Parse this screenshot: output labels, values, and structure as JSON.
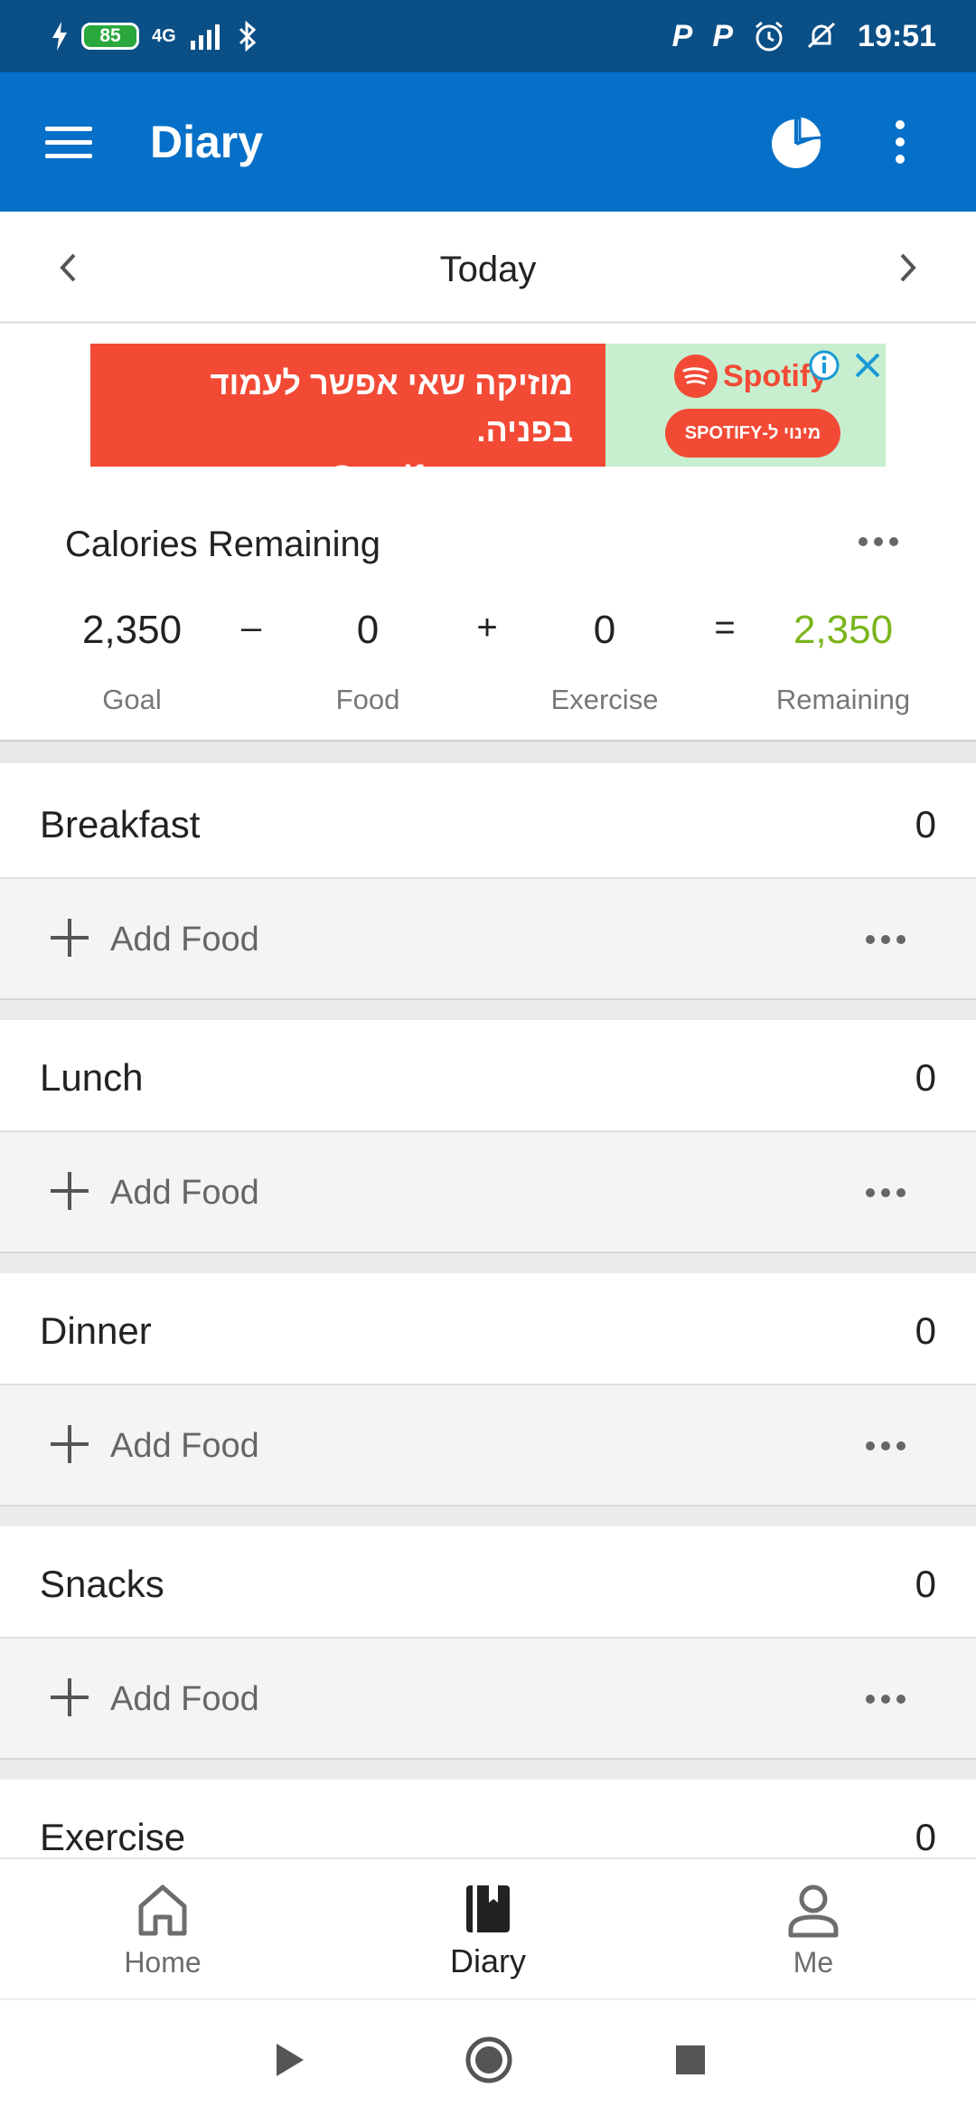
{
  "status_bar": {
    "battery": "85",
    "network": "4G",
    "time": "19:51"
  },
  "app_bar": {
    "title": "Diary"
  },
  "date_nav": {
    "label": "Today"
  },
  "ad": {
    "headline_line1": "מוזיקה שאי אפשר לעמוד בפניה.",
    "headline_line2": "בחינם ב-Spotify.",
    "brand": "Spotify",
    "cta": "מינוי ל-SPOTIFY",
    "accent": "#f24a35",
    "bg_right": "#c7efcf"
  },
  "calories": {
    "title": "Calories Remaining",
    "goal_value": "2,350",
    "goal_label": "Goal",
    "op_minus": "–",
    "food_value": "0",
    "food_label": "Food",
    "op_plus": "+",
    "exercise_value": "0",
    "exercise_label": "Exercise",
    "op_equals": "=",
    "remaining_value": "2,350",
    "remaining_label": "Remaining",
    "remaining_color": "#7ab51d"
  },
  "meals": [
    {
      "name": "Breakfast",
      "calories": "0",
      "add_label": "Add Food"
    },
    {
      "name": "Lunch",
      "calories": "0",
      "add_label": "Add Food"
    },
    {
      "name": "Dinner",
      "calories": "0",
      "add_label": "Add Food"
    },
    {
      "name": "Snacks",
      "calories": "0",
      "add_label": "Add Food"
    },
    {
      "name": "Exercise",
      "calories": "0"
    }
  ],
  "bottom_nav": {
    "home": "Home",
    "diary": "Diary",
    "me": "Me"
  },
  "colors": {
    "status_bar": "#0a4f86",
    "app_bar": "#0670c8"
  }
}
